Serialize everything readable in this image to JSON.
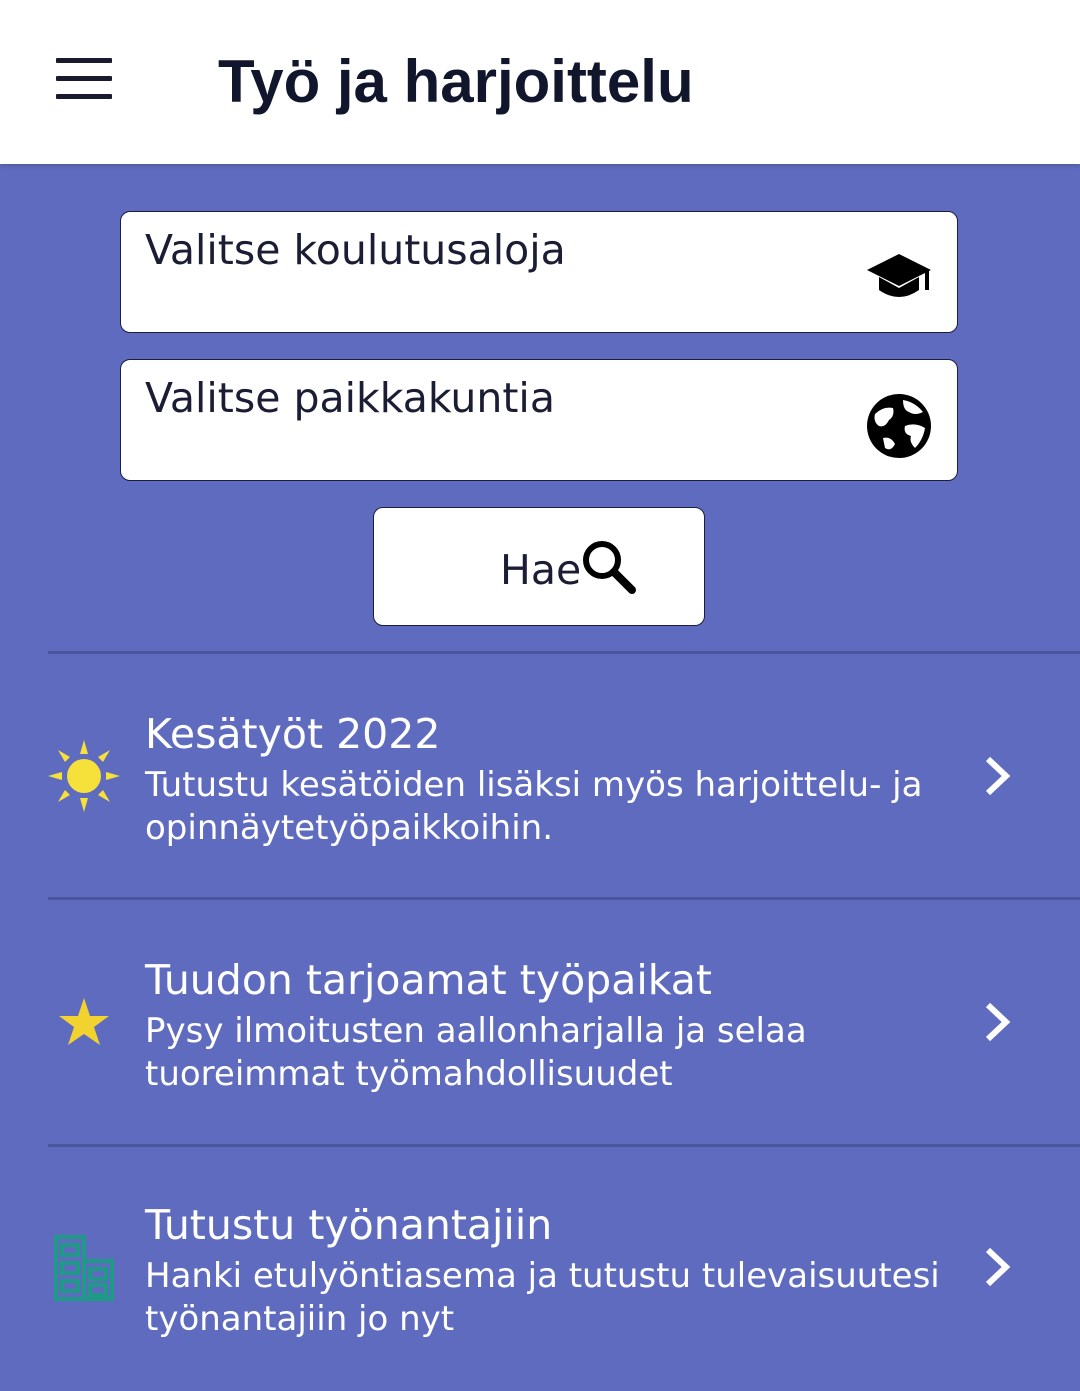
{
  "header": {
    "title": "Työ ja harjoittelu",
    "menu_icon": "hamburger-menu-icon"
  },
  "search": {
    "field_picker": {
      "label": "Valitse koulutusaloja",
      "icon": "graduation-cap-icon"
    },
    "location_picker": {
      "label": "Valitse paikkakuntia",
      "icon": "globe-icon"
    },
    "button": {
      "label": "Hae",
      "icon": "search-icon"
    }
  },
  "list": {
    "items": [
      {
        "title": "Kesätyöt 2022",
        "description": "Tutustu kesätöiden lisäksi myös harjoittelu- ja opinnäytetyöpaikkoihin.",
        "icon": "sun-icon"
      },
      {
        "title": "Tuudon tarjoamat työpaikat",
        "description": "Pysy ilmoitusten aallonharjalla ja selaa tuoreimmat työmahdollisuudet",
        "icon": "star-icon"
      },
      {
        "title": "Tutustu työnantajiin",
        "description": "Hanki etulyöntiasema ja tutustu tulevaisuutesi työnantajiin jo nyt",
        "icon": "buildings-icon"
      }
    ]
  },
  "colors": {
    "background": "#5f6bbf",
    "appbar": "#ffffff",
    "title_text": "#11162c",
    "sun": "#f5e13a",
    "star": "#f2d22e",
    "buildings": "#1f9a86"
  }
}
